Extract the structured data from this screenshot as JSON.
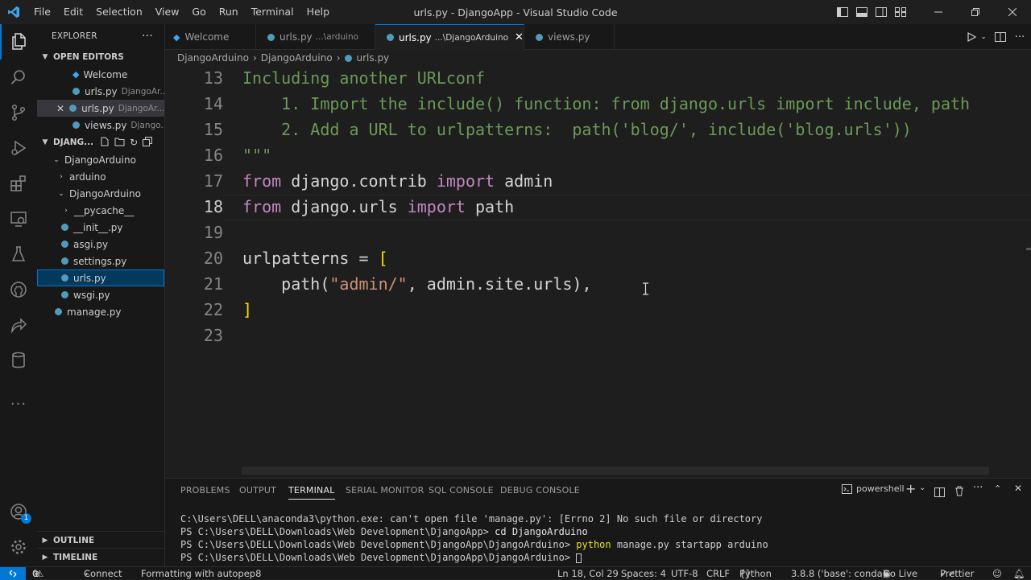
{
  "titlebar": {
    "menu": [
      "File",
      "Edit",
      "Selection",
      "View",
      "Go",
      "Run",
      "Terminal",
      "Help"
    ],
    "title": "urls.py - DjangoApp - Visual Studio Code"
  },
  "activitybar": {
    "icons": [
      "files-icon",
      "search-icon",
      "source-control-icon",
      "run-debug-icon",
      "extensions-icon",
      "remote-explorer-icon",
      "testing-icon",
      "github-icon",
      "live-share-icon",
      "database-icon",
      "more-icon"
    ],
    "account_badge": "1"
  },
  "sidebar": {
    "title": "EXPLORER",
    "open_editors": {
      "label": "OPEN EDITORS",
      "items": [
        {
          "name": "Welcome",
          "desc": ""
        },
        {
          "name": "urls.py",
          "desc": "DjangoAr..."
        },
        {
          "name": "urls.py",
          "desc": "DjangoAr..."
        },
        {
          "name": "views.py",
          "desc": "Django..."
        }
      ]
    },
    "workspace": {
      "label": "DJANG...",
      "tree": [
        {
          "name": "DjangoArduino"
        },
        {
          "name": "arduino"
        },
        {
          "name": "DjangoArduino"
        },
        {
          "name": "__pycache__"
        },
        {
          "name": "__init__.py"
        },
        {
          "name": "asgi.py"
        },
        {
          "name": "settings.py"
        },
        {
          "name": "urls.py"
        },
        {
          "name": "wsgi.py"
        },
        {
          "name": "manage.py"
        }
      ]
    },
    "outline_label": "OUTLINE",
    "timeline_label": "TIMELINE"
  },
  "tabs": [
    {
      "name": "Welcome",
      "desc": ""
    },
    {
      "name": "urls.py",
      "desc": "...\\arduino"
    },
    {
      "name": "urls.py",
      "desc": "...\\DjangoArduino"
    },
    {
      "name": "views.py",
      "desc": ""
    }
  ],
  "breadcrumb": [
    "DjangoArduino",
    "DjangoArduino",
    "urls.py"
  ],
  "editor": {
    "line_numbers": [
      "13",
      "14",
      "15",
      "16",
      "17",
      "18",
      "19",
      "20",
      "21",
      "22",
      "23"
    ],
    "current_line": "18",
    "lines": {
      "l13": "Including another URLconf",
      "l14": "    1. Import the include() function: from django.urls import include, path",
      "l15": "    2. Add a URL to urlpatterns:  path('blog/', include('blog.urls'))",
      "l16": "\"\"\"",
      "l17": {
        "kw1": "from",
        "mod": " django.contrib ",
        "kw2": "import",
        "name": " admin"
      },
      "l18": {
        "kw1": "from",
        "mod": " django.urls ",
        "kw2": "import",
        "name": " path"
      },
      "l20": {
        "name": "urlpatterns",
        "op": " = ",
        "bracket": "["
      },
      "l21": {
        "indent": "    ",
        "fn": "path",
        "open": "(",
        "str": "\"admin/\"",
        "rest": ", admin.site.urls),"
      },
      "l22": "]"
    }
  },
  "panel": {
    "tabs": [
      "PROBLEMS",
      "OUTPUT",
      "TERMINAL",
      "SERIAL MONITOR",
      "SQL CONSOLE",
      "DEBUG CONSOLE"
    ],
    "active_tab": "TERMINAL",
    "shell": "powershell",
    "terminal_lines": {
      "t1": "C:\\Users\\DELL\\anaconda3\\python.exe: can't open file 'manage.py': [Errno 2] No such file or directory",
      "t2_prompt": "PS C:\\Users\\DELL\\Downloads\\Web Development\\DjangoApp> ",
      "t2_cmd": "cd DjangoArduino",
      "t3_prompt": "PS C:\\Users\\DELL\\Downloads\\Web Development\\DjangoApp\\DjangoArduino> ",
      "t3_cmd": "python",
      "t3_args": " manage.py startapp arduino",
      "t4_prompt": "PS C:\\Users\\DELL\\Downloads\\Web Development\\DjangoApp\\DjangoArduino> "
    }
  },
  "statusbar": {
    "problems": "0",
    "warnings": "0",
    "connect": "Connect",
    "formatting": "Formatting with autopep8",
    "position": "Ln 18, Col 29",
    "spaces": "Spaces: 4",
    "encoding": "UTF-8",
    "eol": "CRLF",
    "language": "Python",
    "interpreter": "3.8.8 ('base': conda)",
    "golive": "Go Live",
    "prettier": "Prettier"
  },
  "colors": {
    "accent": "#0078d4",
    "comment": "#6a9955",
    "keyword": "#c586c0",
    "string": "#ce9178",
    "python_icon": "#519aba"
  }
}
